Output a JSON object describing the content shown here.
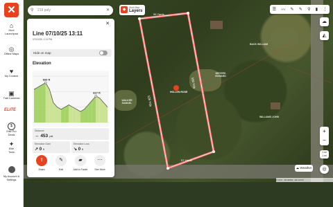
{
  "app": {
    "logo": "✕"
  },
  "sidebar": {
    "items": [
      {
        "label1": "Hunt",
        "label2": "Launchpad",
        "icon": "⌂"
      },
      {
        "label1": "Offline Maps",
        "label2": "",
        "icon": "◎"
      },
      {
        "label1": "My Content",
        "label2": "",
        "icon": "♥"
      },
      {
        "label1": "Trail Cameras",
        "label2": "",
        "icon": "▣"
      }
    ],
    "elite_label": "ELITE",
    "elite_items": [
      {
        "label1": "Elite Pro",
        "label2": "Deals",
        "icon": "$"
      },
      {
        "label1": "Elite",
        "label2": "Tools",
        "icon": "✦"
      }
    ],
    "account": {
      "label1": "My Account &",
      "label2": "Settings"
    }
  },
  "search": {
    "placeholder": "219 poly"
  },
  "layers": {
    "line1": "Hunt Map",
    "line2": "Layers"
  },
  "toolbar_icons": [
    "☰",
    "〰",
    "✎",
    "✎",
    "⚲",
    "▮",
    "⋮"
  ],
  "panel": {
    "title": "Line 07/10/25 13:11",
    "subtitle": "07/10/25, 1:11 PM",
    "hide_label": "Hide on map",
    "elevation_heading": "Elevation",
    "stats": {
      "distance_label": "Distance",
      "distance_value": "453",
      "distance_unit": "yds",
      "gain_label": "Elevation Gain",
      "gain_value": "0",
      "gain_unit": "ft",
      "loss_label": "Elevation Loss",
      "loss_value": "0",
      "loss_unit": "ft"
    },
    "actions": [
      {
        "label": "Share",
        "icon": "⇪"
      },
      {
        "label": "Edit",
        "icon": "✎"
      },
      {
        "label": "Add to Folder",
        "icon": "▰"
      },
      {
        "label": "See More",
        "icon": "⋯"
      }
    ]
  },
  "chart_data": {
    "type": "area",
    "x": [
      0,
      1,
      2,
      3,
      4,
      5,
      6,
      7,
      8,
      9,
      10,
      11,
      12,
      13,
      14,
      15,
      16,
      17,
      18,
      19
    ],
    "values": [
      830,
      831,
      832,
      833,
      830,
      824,
      822,
      821,
      822,
      823,
      822,
      821,
      820,
      821,
      823,
      825,
      827,
      826,
      824,
      822
    ],
    "point_labels": [
      {
        "index": 3,
        "text": "833 ft"
      },
      {
        "index": 16,
        "text": "827 ft"
      }
    ],
    "ylim": [
      815,
      836
    ],
    "grid": true
  },
  "map": {
    "labels": [
      {
        "text": "56 Yards"
      },
      {
        "text": "57 Yards"
      },
      {
        "text": "126 Yds"
      },
      {
        "text": "160 Yds"
      },
      {
        "text": "HOLLEN ROSE"
      }
    ],
    "parcel_tags": [
      "WALKER SAMUEL",
      "BACK WILLIAM",
      "MEYERS EDWARD",
      "WILLIAMS JOHN"
    ],
    "weather_label": "Weather",
    "scale_line1": "1 mi",
    "scale_line2": "1 mi",
    "attribution": "© OnX  ·  45.42654, -93.12170"
  },
  "colors": {
    "accent": "#e8411e",
    "line": "#ff7a7a"
  }
}
